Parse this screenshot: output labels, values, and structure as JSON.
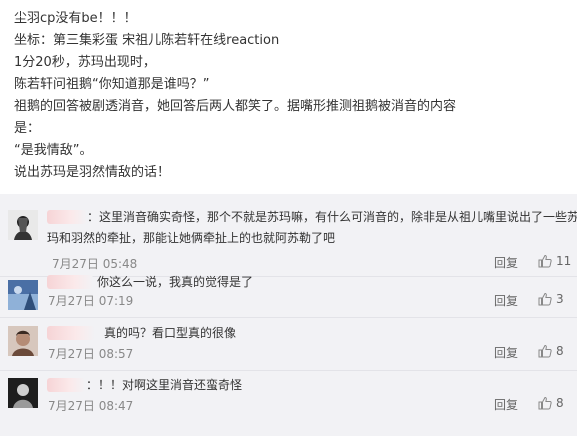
{
  "post": {
    "lines": [
      "尘羽cp没有be！！！",
      "坐标：第三集彩蛋 宋祖儿陈若轩在线reaction",
      "1分20秒，苏玛出现时，",
      "陈若轩问祖鹅“你知道那是谁吗？”",
      "祖鹅的回答被剧透消音，她回答后两人都笑了。据嘴形推测祖鹅被消音的内容",
      "是：",
      "“是我情敌”。",
      "说出苏玛是羽然情敌的话！"
    ]
  },
  "comments": [
    {
      "text_line1": "：这里消音确实奇怪，那个不就是苏玛嘛，有什么可消音的，除非是从祖儿嘴里说出了一些苏",
      "text_line2": "玛和羽然的牵扯，那能让她俩牵扯上的也就阿苏勒了吧",
      "time": "7月27日 05:48",
      "reply_label": "回复",
      "likes": "11"
    },
    {
      "text_line1": "你这么一说，我真的觉得是了",
      "time": "7月27日 07:19",
      "reply_label": "回复",
      "likes": "3"
    },
    {
      "text_line1": "真的吗？看口型真的很像",
      "time": "7月27日 08:57",
      "reply_label": "回复",
      "likes": "8"
    },
    {
      "text_line1": "：！！对啊这里消音还蛮奇怪",
      "time": "7月27日 08:47",
      "reply_label": "回复",
      "likes": "8"
    }
  ],
  "colors": {
    "comment_bg": "#f2f2f5",
    "nick_blur": "#f6d4d6",
    "meta": "#888888"
  },
  "icons": [
    "thumbs-up-icon",
    "avatar"
  ]
}
